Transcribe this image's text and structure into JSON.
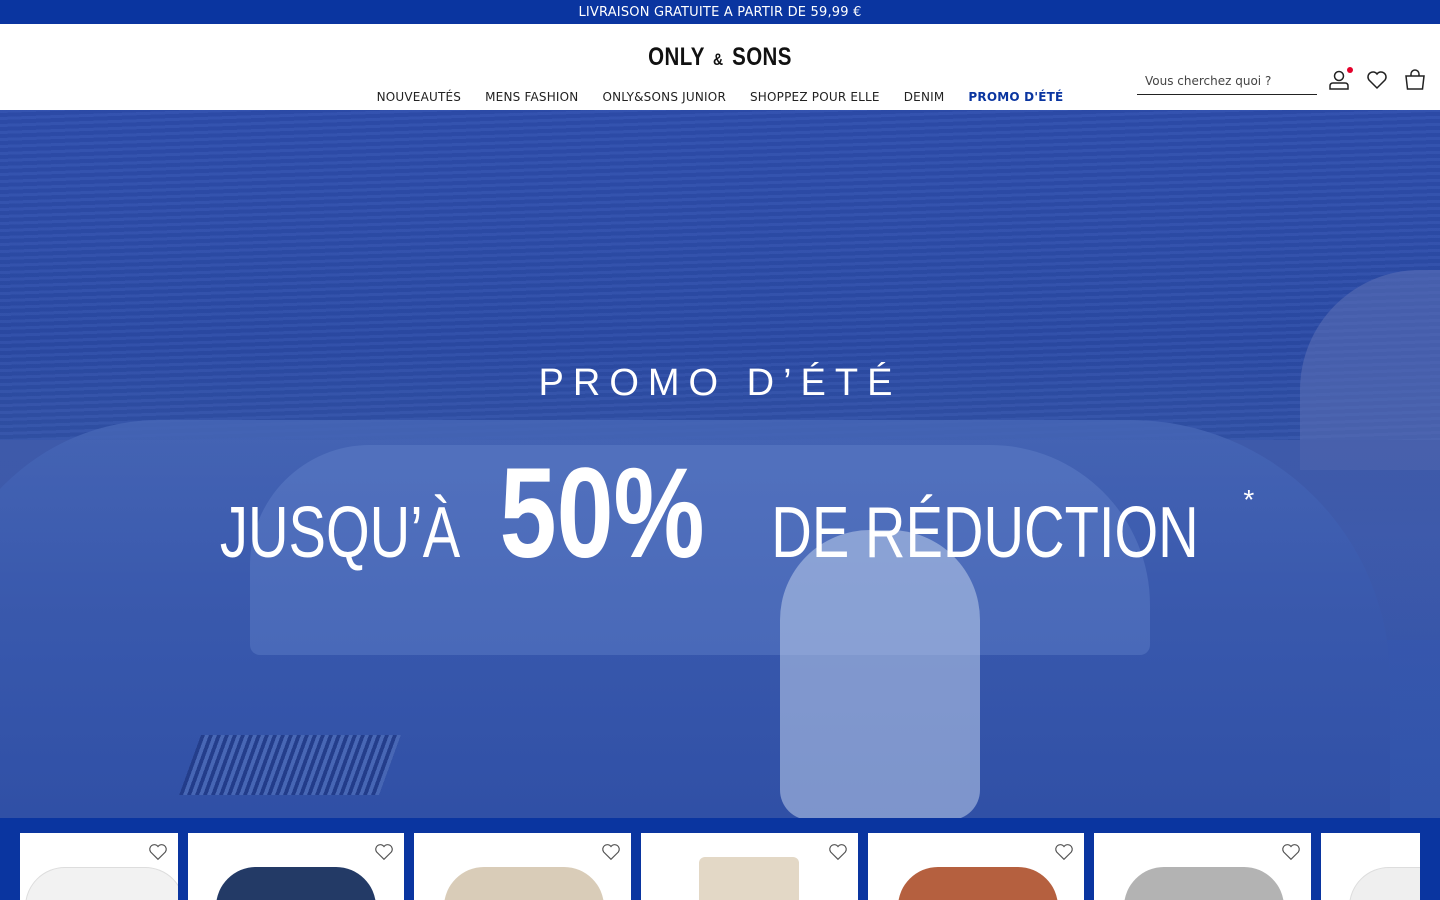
{
  "announcement": {
    "text": "LIVRAISON GRATUITE A PARTIR DE 59,99 €"
  },
  "brand": {
    "logo_left": "ONLY",
    "logo_amp": "&",
    "logo_right": "SONS"
  },
  "search": {
    "placeholder": "Vous cherchez quoi ?"
  },
  "header_icons": {
    "account": "user-icon",
    "wishlist": "heart-icon",
    "bag": "shopping-bag-icon",
    "notification_color": "#e4002b"
  },
  "nav": {
    "items": [
      {
        "label": "NOUVEAUTÉS"
      },
      {
        "label": "MENS FASHION"
      },
      {
        "label": "ONLY&SONS JUNIOR"
      },
      {
        "label": "SHOPPEZ POUR ELLE"
      },
      {
        "label": "DENIM"
      },
      {
        "label": "PROMO D'ÉTÉ"
      }
    ]
  },
  "hero": {
    "subtitle": "PROMO D’ÉTÉ",
    "prefix": "JUSQU’À",
    "discount": "50%",
    "suffix": "DE RÉDUCTION",
    "asterisk": "*"
  },
  "colors": {
    "brand_blue": "#0a35a0",
    "text": "#222222"
  },
  "products": [
    {
      "name": "white-tshirt",
      "color": "#f2f2f2"
    },
    {
      "name": "navy-tshirt",
      "color": "#233a66"
    },
    {
      "name": "beige-tshirt",
      "color": "#d9ccb8"
    },
    {
      "name": "beige-shorts",
      "color": "#e3d8c6"
    },
    {
      "name": "rust-tshirt",
      "color": "#b5603f"
    },
    {
      "name": "grey-tshirt",
      "color": "#b3b3b3"
    },
    {
      "name": "white-tshirt-2",
      "color": "#efefef"
    }
  ]
}
